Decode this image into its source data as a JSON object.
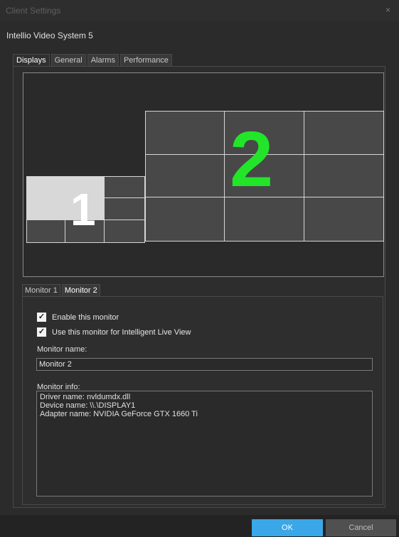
{
  "window": {
    "title": "Client Settings",
    "close_glyph": "×"
  },
  "system_name": "Intellio Video System 5",
  "tabs": [
    {
      "label": "Displays",
      "active": true
    },
    {
      "label": "General",
      "active": false
    },
    {
      "label": "Alarms",
      "active": false
    },
    {
      "label": "Performance",
      "active": false
    }
  ],
  "displays": {
    "monitor1_number": "1",
    "monitor2_number": "2",
    "monitor2_number_color": "#22e52a"
  },
  "monitor_tabs": [
    {
      "label": "Monitor 1",
      "active": false
    },
    {
      "label": "Monitor 2",
      "active": true
    }
  ],
  "options": {
    "enable_monitor": {
      "label": "Enable this monitor",
      "checked": true
    },
    "live_view": {
      "label": "Use this monitor for Intelligent Live View",
      "checked": true
    }
  },
  "monitor_name": {
    "label": "Monitor name:",
    "value": "Monitor 2"
  },
  "monitor_info": {
    "label": "Monitor info:",
    "lines": [
      "Driver name: nvldumdx.dll",
      "Device name: \\\\.\\DISPLAY1",
      "Adapter name: NVIDIA GeForce GTX 1660 Ti"
    ]
  },
  "buttons": {
    "ok": "OK",
    "cancel": "Cancel"
  },
  "colors": {
    "accent": "#3aa7e8",
    "monitor1_border": "#6b8eaa",
    "monitor2_border": "#b08f57"
  }
}
